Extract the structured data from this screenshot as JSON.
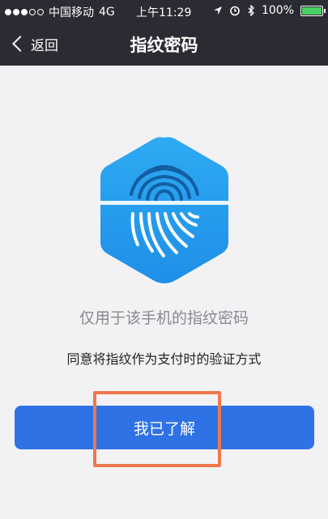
{
  "status_bar": {
    "carrier": "中国移动",
    "network": "4G",
    "time": "上午11:29",
    "battery": "100%",
    "signal_bars": 3,
    "signal_total": 5
  },
  "nav": {
    "back_label": "返回",
    "title": "指纹密码"
  },
  "main": {
    "icon": "fingerprint-icon",
    "info_line": "仅用于该手机的指纹密码",
    "agreement_line": "同意将指纹作为支付时的验证方式",
    "confirm_label": "我已了解"
  },
  "colors": {
    "nav_bg": "#2b2c33",
    "button_bg": "#2f72e6",
    "icon_blue": "#2aa0ef",
    "highlight": "#f0784a",
    "battery": "#47d162"
  }
}
